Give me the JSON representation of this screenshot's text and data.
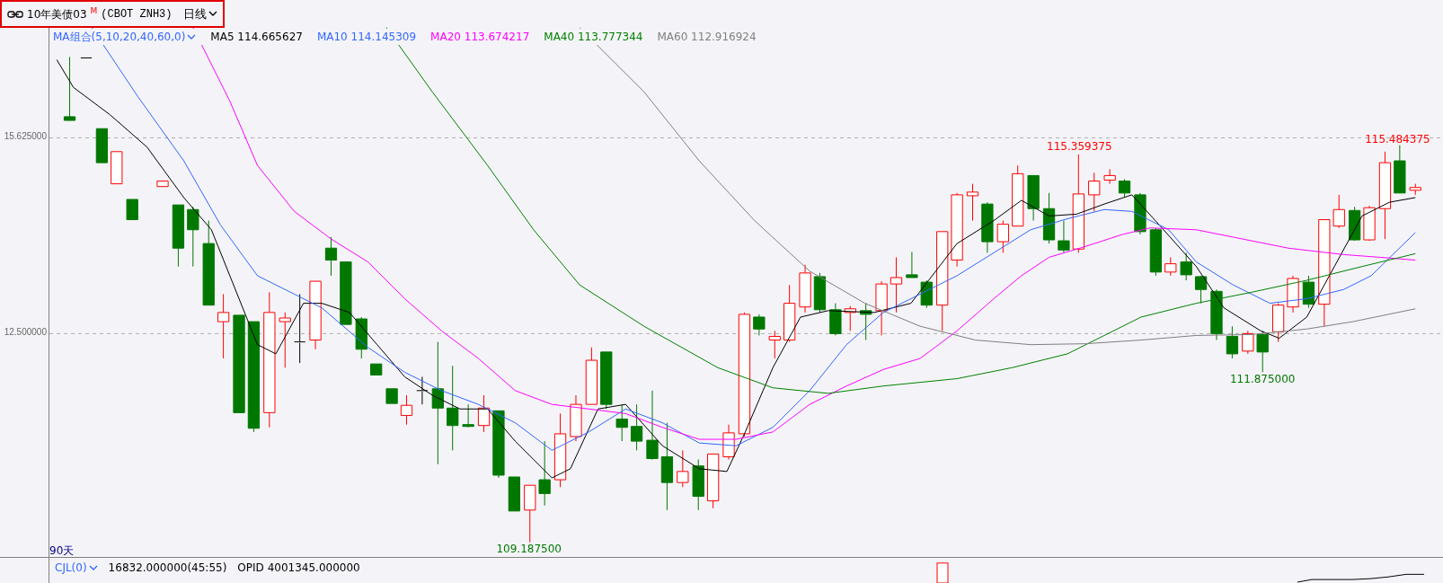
{
  "header": {
    "instrument": "10年美债03",
    "marker": "M",
    "code": "(CBOT ZNH3)",
    "period": "日线"
  },
  "indicator_legend": {
    "selector": "MA组合(5,10,20,40,60,0)",
    "items": [
      {
        "label": "MA5 114.665627",
        "color": "#000000"
      },
      {
        "label": "MA10 114.145309",
        "color": "#3366ff"
      },
      {
        "label": "MA20 113.674217",
        "color": "#ff00ff"
      },
      {
        "label": "MA40 113.777344",
        "color": "#008000"
      },
      {
        "label": "MA60 112.916924",
        "color": "#808080"
      }
    ]
  },
  "price_chart": {
    "y_axis_labels": [
      "15.625000",
      "12.500000"
    ],
    "annotations": [
      {
        "text": "115.359375",
        "kind": "high"
      },
      {
        "text": "115.484375",
        "kind": "high"
      },
      {
        "text": "111.875000",
        "kind": "low"
      },
      {
        "text": "109.187500",
        "kind": "low"
      }
    ],
    "range_label": "90天"
  },
  "volume_pane": {
    "selector": "CJL(0)",
    "values": [
      "16832.000000(45:55)",
      "OPID 4001345.000000"
    ]
  }
}
